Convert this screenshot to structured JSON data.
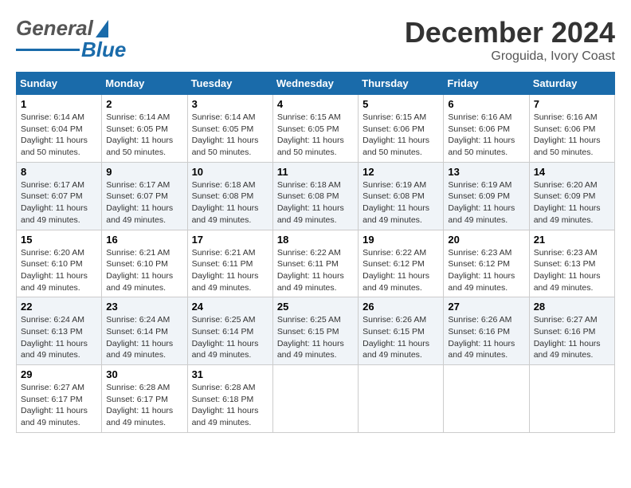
{
  "header": {
    "logo_general": "General",
    "logo_blue": "Blue",
    "month": "December 2024",
    "location": "Groguida, Ivory Coast"
  },
  "days_of_week": [
    "Sunday",
    "Monday",
    "Tuesday",
    "Wednesday",
    "Thursday",
    "Friday",
    "Saturday"
  ],
  "weeks": [
    [
      {
        "day": "1",
        "sunrise": "6:14 AM",
        "sunset": "6:04 PM",
        "daylight": "11 hours and 50 minutes."
      },
      {
        "day": "2",
        "sunrise": "6:14 AM",
        "sunset": "6:05 PM",
        "daylight": "11 hours and 50 minutes."
      },
      {
        "day": "3",
        "sunrise": "6:14 AM",
        "sunset": "6:05 PM",
        "daylight": "11 hours and 50 minutes."
      },
      {
        "day": "4",
        "sunrise": "6:15 AM",
        "sunset": "6:05 PM",
        "daylight": "11 hours and 50 minutes."
      },
      {
        "day": "5",
        "sunrise": "6:15 AM",
        "sunset": "6:06 PM",
        "daylight": "11 hours and 50 minutes."
      },
      {
        "day": "6",
        "sunrise": "6:16 AM",
        "sunset": "6:06 PM",
        "daylight": "11 hours and 50 minutes."
      },
      {
        "day": "7",
        "sunrise": "6:16 AM",
        "sunset": "6:06 PM",
        "daylight": "11 hours and 50 minutes."
      }
    ],
    [
      {
        "day": "8",
        "sunrise": "6:17 AM",
        "sunset": "6:07 PM",
        "daylight": "11 hours and 49 minutes."
      },
      {
        "day": "9",
        "sunrise": "6:17 AM",
        "sunset": "6:07 PM",
        "daylight": "11 hours and 49 minutes."
      },
      {
        "day": "10",
        "sunrise": "6:18 AM",
        "sunset": "6:08 PM",
        "daylight": "11 hours and 49 minutes."
      },
      {
        "day": "11",
        "sunrise": "6:18 AM",
        "sunset": "6:08 PM",
        "daylight": "11 hours and 49 minutes."
      },
      {
        "day": "12",
        "sunrise": "6:19 AM",
        "sunset": "6:08 PM",
        "daylight": "11 hours and 49 minutes."
      },
      {
        "day": "13",
        "sunrise": "6:19 AM",
        "sunset": "6:09 PM",
        "daylight": "11 hours and 49 minutes."
      },
      {
        "day": "14",
        "sunrise": "6:20 AM",
        "sunset": "6:09 PM",
        "daylight": "11 hours and 49 minutes."
      }
    ],
    [
      {
        "day": "15",
        "sunrise": "6:20 AM",
        "sunset": "6:10 PM",
        "daylight": "11 hours and 49 minutes."
      },
      {
        "day": "16",
        "sunrise": "6:21 AM",
        "sunset": "6:10 PM",
        "daylight": "11 hours and 49 minutes."
      },
      {
        "day": "17",
        "sunrise": "6:21 AM",
        "sunset": "6:11 PM",
        "daylight": "11 hours and 49 minutes."
      },
      {
        "day": "18",
        "sunrise": "6:22 AM",
        "sunset": "6:11 PM",
        "daylight": "11 hours and 49 minutes."
      },
      {
        "day": "19",
        "sunrise": "6:22 AM",
        "sunset": "6:12 PM",
        "daylight": "11 hours and 49 minutes."
      },
      {
        "day": "20",
        "sunrise": "6:23 AM",
        "sunset": "6:12 PM",
        "daylight": "11 hours and 49 minutes."
      },
      {
        "day": "21",
        "sunrise": "6:23 AM",
        "sunset": "6:13 PM",
        "daylight": "11 hours and 49 minutes."
      }
    ],
    [
      {
        "day": "22",
        "sunrise": "6:24 AM",
        "sunset": "6:13 PM",
        "daylight": "11 hours and 49 minutes."
      },
      {
        "day": "23",
        "sunrise": "6:24 AM",
        "sunset": "6:14 PM",
        "daylight": "11 hours and 49 minutes."
      },
      {
        "day": "24",
        "sunrise": "6:25 AM",
        "sunset": "6:14 PM",
        "daylight": "11 hours and 49 minutes."
      },
      {
        "day": "25",
        "sunrise": "6:25 AM",
        "sunset": "6:15 PM",
        "daylight": "11 hours and 49 minutes."
      },
      {
        "day": "26",
        "sunrise": "6:26 AM",
        "sunset": "6:15 PM",
        "daylight": "11 hours and 49 minutes."
      },
      {
        "day": "27",
        "sunrise": "6:26 AM",
        "sunset": "6:16 PM",
        "daylight": "11 hours and 49 minutes."
      },
      {
        "day": "28",
        "sunrise": "6:27 AM",
        "sunset": "6:16 PM",
        "daylight": "11 hours and 49 minutes."
      }
    ],
    [
      {
        "day": "29",
        "sunrise": "6:27 AM",
        "sunset": "6:17 PM",
        "daylight": "11 hours and 49 minutes."
      },
      {
        "day": "30",
        "sunrise": "6:28 AM",
        "sunset": "6:17 PM",
        "daylight": "11 hours and 49 minutes."
      },
      {
        "day": "31",
        "sunrise": "6:28 AM",
        "sunset": "6:18 PM",
        "daylight": "11 hours and 49 minutes."
      },
      null,
      null,
      null,
      null
    ]
  ],
  "labels": {
    "sunrise": "Sunrise:",
    "sunset": "Sunset:",
    "daylight": "Daylight:"
  }
}
